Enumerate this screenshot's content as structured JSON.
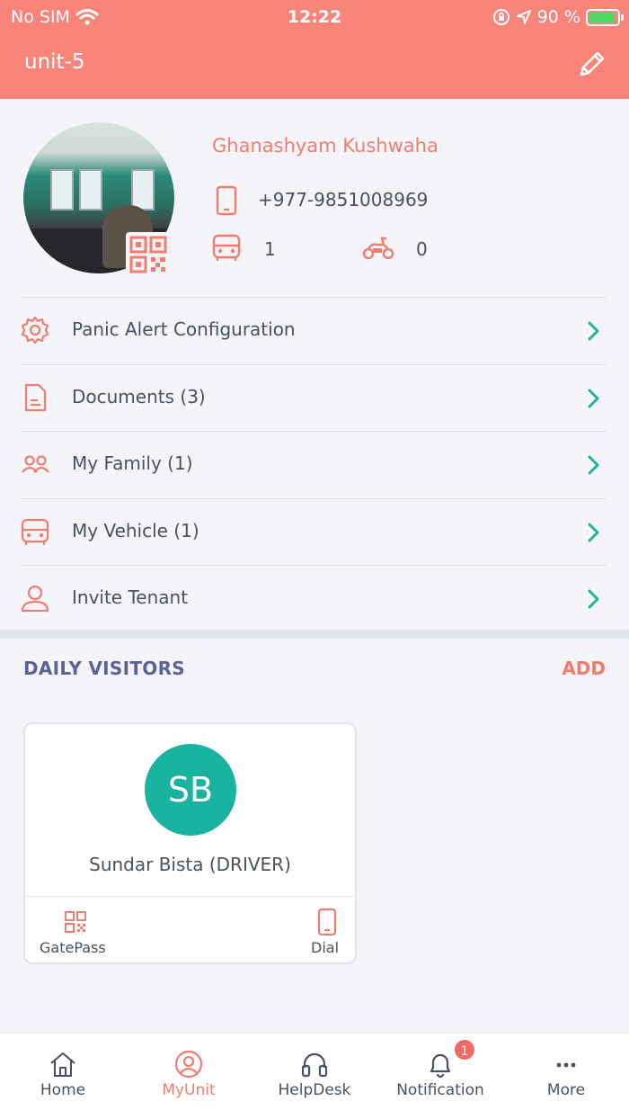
{
  "status_bar": {
    "carrier": "No SIM",
    "time": "12:22",
    "battery": "90 %"
  },
  "header": {
    "title": "unit-5",
    "edit_icon": "pencil-icon"
  },
  "profile": {
    "name": "Ghanashyam Kushwaha",
    "phone": "+977-9851008969",
    "car_count": "1",
    "scooter_count": "0"
  },
  "menu": [
    {
      "label": "Panic Alert Configuration",
      "icon": "gear-icon"
    },
    {
      "label": "Documents (3)",
      "icon": "document-icon"
    },
    {
      "label": "My Family (1)",
      "icon": "family-icon"
    },
    {
      "label": "My Vehicle (1)",
      "icon": "car-icon"
    },
    {
      "label": "Invite Tenant",
      "icon": "user-icon"
    }
  ],
  "daily_visitors": {
    "title": "DAILY VISITORS",
    "add_label": "ADD",
    "visitors": [
      {
        "initials": "SB",
        "name": "Sundar Bista (DRIVER)",
        "gatepass_label": "GatePass",
        "dial_label": "Dial"
      }
    ]
  },
  "tabbar": {
    "tabs": [
      {
        "label": "Home",
        "icon": "home-icon"
      },
      {
        "label": "MyUnit",
        "icon": "user-circle-icon",
        "active": true
      },
      {
        "label": "HelpDesk",
        "icon": "headphones-icon"
      },
      {
        "label": "Notification",
        "icon": "bell-icon",
        "badge": "1"
      },
      {
        "label": "More",
        "icon": "more-icon"
      }
    ]
  },
  "colors": {
    "header": "#f9857a",
    "accent": "#f27c70",
    "teal": "#1ab3a0",
    "section_title": "#5a6296"
  }
}
